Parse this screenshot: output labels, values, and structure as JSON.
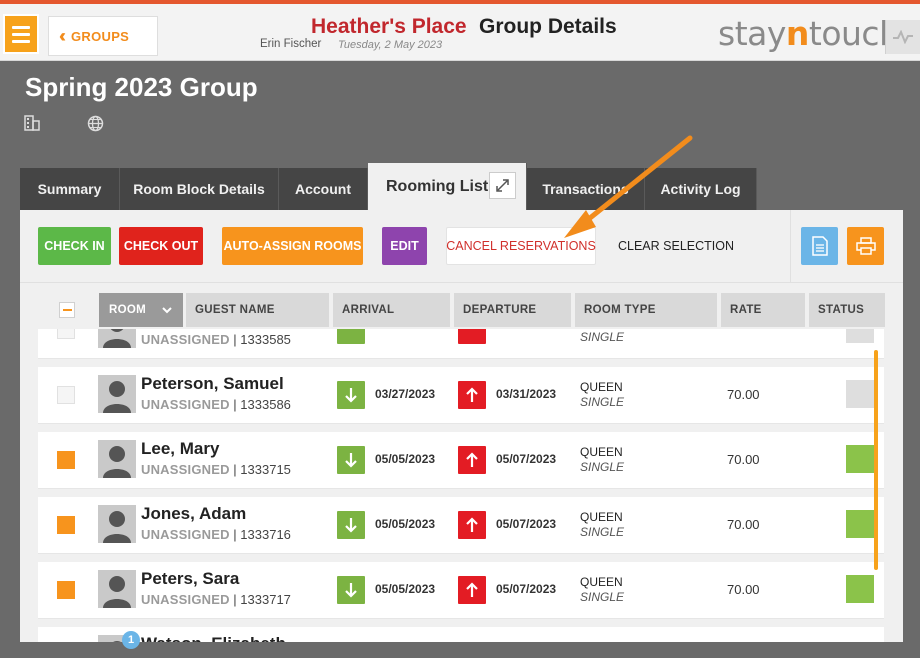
{
  "header": {
    "groups_label": "GROUPS",
    "hotel_name": "Heather's Place",
    "page_title": "Group Details",
    "user_name": "Erin Fischer",
    "date": "Tuesday, 2 May 2023",
    "logo_prefix": "stay",
    "logo_accent": "n",
    "logo_suffix": "touch"
  },
  "group": {
    "title": "Spring 2023 Group"
  },
  "tabs": [
    {
      "label": "Summary"
    },
    {
      "label": "Room Block Details"
    },
    {
      "label": "Account"
    },
    {
      "label": "Rooming List",
      "active": true
    },
    {
      "label": "Transactions"
    },
    {
      "label": "Activity Log"
    }
  ],
  "toolbar": {
    "check_in": "CHECK IN",
    "check_out": "CHECK OUT",
    "auto_assign": "AUTO-ASSIGN ROOMS",
    "edit": "EDIT",
    "cancel_reservations": "CANCEL RESERVATIONS",
    "clear_selection": "CLEAR SELECTION"
  },
  "columns": {
    "room": "ROOM",
    "guest_name": "GUEST NAME",
    "arrival": "ARRIVAL",
    "departure": "DEPARTURE",
    "room_type": "ROOM TYPE",
    "rate": "RATE",
    "status": "STATUS"
  },
  "rows": [
    {
      "name": "",
      "room": "UNASSIGNED",
      "conf": "1333585",
      "arrival": "",
      "departure": "",
      "type": "",
      "subtype": "SINGLE",
      "rate": "",
      "selected": false,
      "status": "gray"
    },
    {
      "name": "Peterson, Samuel",
      "room": "UNASSIGNED",
      "conf": "1333586",
      "arrival": "03/27/2023",
      "departure": "03/31/2023",
      "type": "QUEEN",
      "subtype": "SINGLE",
      "rate": "70.00",
      "selected": false,
      "status": "gray"
    },
    {
      "name": "Lee, Mary",
      "room": "UNASSIGNED",
      "conf": "1333715",
      "arrival": "05/05/2023",
      "departure": "05/07/2023",
      "type": "QUEEN",
      "subtype": "SINGLE",
      "rate": "70.00",
      "selected": true,
      "status": "green"
    },
    {
      "name": "Jones, Adam",
      "room": "UNASSIGNED",
      "conf": "1333716",
      "arrival": "05/05/2023",
      "departure": "05/07/2023",
      "type": "QUEEN",
      "subtype": "SINGLE",
      "rate": "70.00",
      "selected": true,
      "status": "green"
    },
    {
      "name": "Peters, Sara",
      "room": "UNASSIGNED",
      "conf": "1333717",
      "arrival": "05/05/2023",
      "departure": "05/07/2023",
      "type": "QUEEN",
      "subtype": "SINGLE",
      "rate": "70.00",
      "selected": true,
      "status": "green"
    }
  ],
  "peek_row": {
    "badge": "1",
    "name": "Watson, Elizabeth"
  },
  "colors": {
    "accent_orange": "#f7941d",
    "brand_red": "#c1272d",
    "check_in_green": "#5cb848",
    "check_out_red": "#e0231c",
    "edit_purple": "#8e44ad",
    "status_green": "#8bc34a"
  }
}
